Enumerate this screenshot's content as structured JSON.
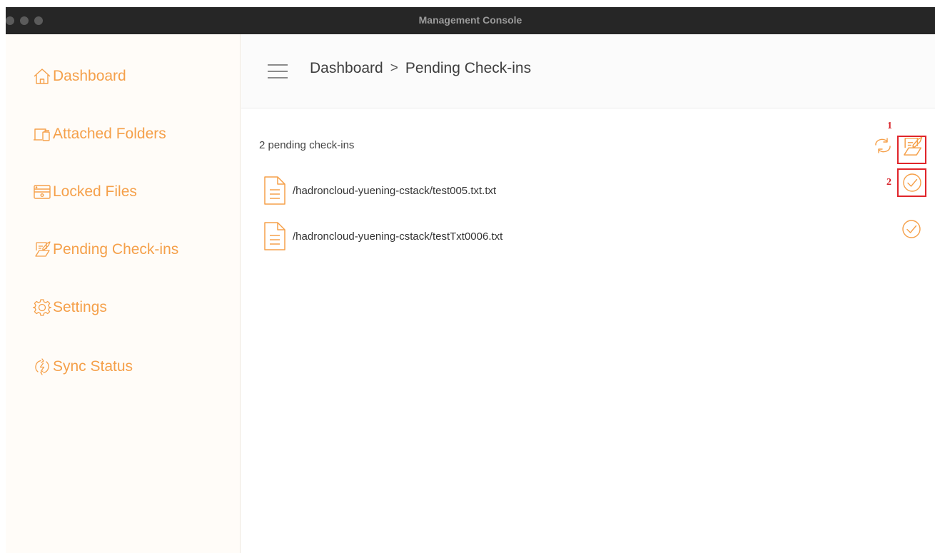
{
  "window": {
    "title": "Management Console"
  },
  "sidebar": {
    "items": [
      {
        "label": "Dashboard",
        "icon": "home-icon"
      },
      {
        "label": "Attached Folders",
        "icon": "folders-icon"
      },
      {
        "label": "Locked Files",
        "icon": "locked-files-icon"
      },
      {
        "label": "Pending Check-ins",
        "icon": "pending-checkin-icon"
      },
      {
        "label": "Settings",
        "icon": "gear-icon"
      },
      {
        "label": "Sync Status",
        "icon": "sync-icon"
      }
    ]
  },
  "header": {
    "breadcrumb": {
      "parent": "Dashboard",
      "separator": ">",
      "current": "Pending Check-ins"
    }
  },
  "content": {
    "count_label": "2 pending check-ins",
    "files": [
      {
        "path": "/hadroncloud-yuening-cstack/test005.txt.txt",
        "icon": "document-icon",
        "action_icon": "check-circle-icon"
      },
      {
        "path": "/hadroncloud-yuening-cstack/testTxt0006.txt",
        "icon": "document-icon",
        "action_icon": "check-circle-icon"
      }
    ],
    "toolbar": {
      "refresh_icon": "refresh-icon",
      "checkin_all_icon": "pending-checkin-icon"
    }
  },
  "annotations": [
    {
      "label": "1"
    },
    {
      "label": "2"
    }
  ],
  "colors": {
    "accent": "#f5a04a",
    "titlebar": "#262626",
    "annotation": "#e0242a"
  }
}
